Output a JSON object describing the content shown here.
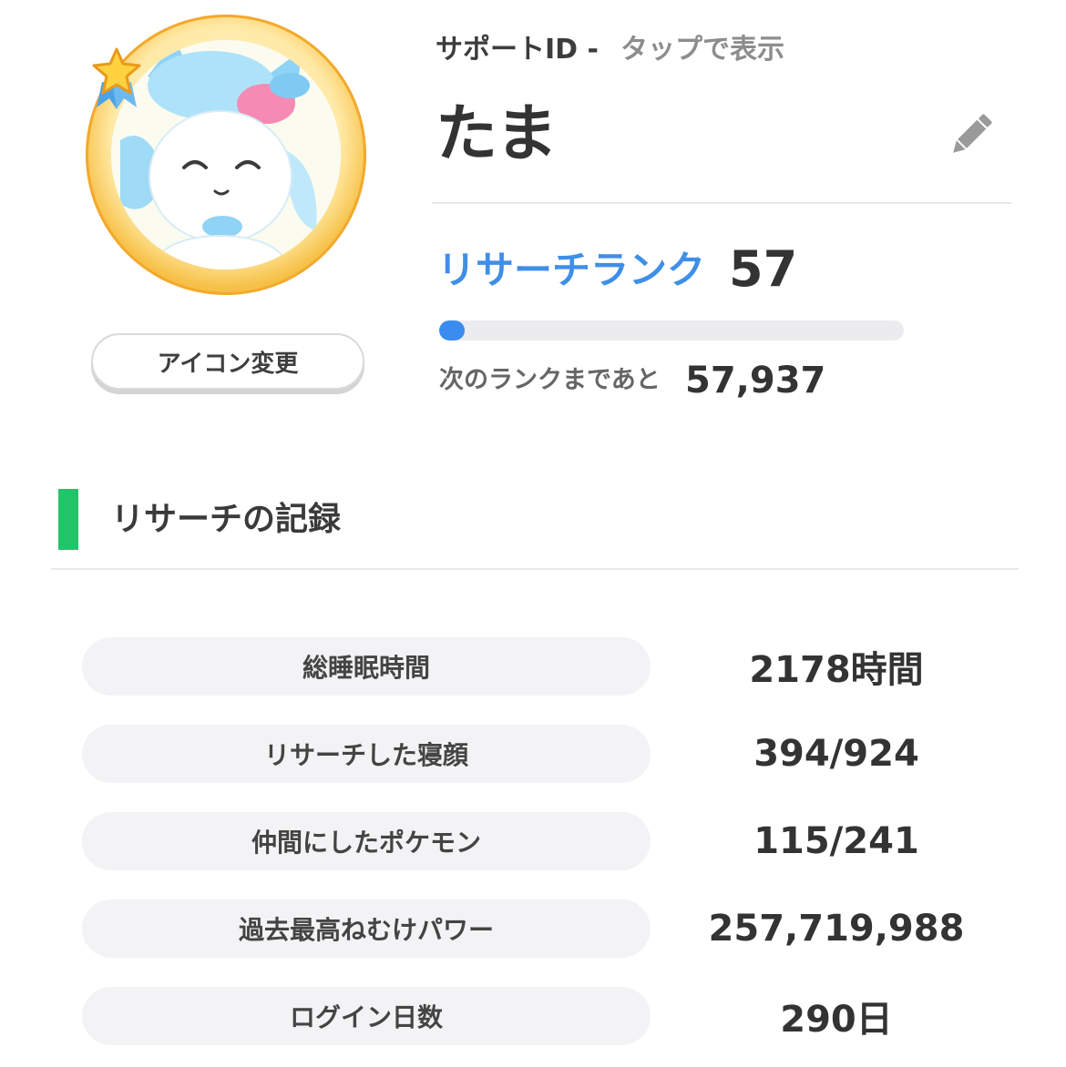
{
  "profile": {
    "support_id_label": "サポートID -",
    "support_id_value": "タップで表示",
    "name": "たま",
    "edit_icon": "pencil-icon",
    "avatar_icon": "sylveon-portrait",
    "badge_icon": "star-ribbon-icon",
    "icon_change_label": "アイコン変更"
  },
  "rank": {
    "label": "リサーチランク",
    "value": "57",
    "progress_fraction": 0.055,
    "next_label": "次のランクまであと",
    "next_value": "57,937",
    "accent_color": "#3f8fe8",
    "bar_color": "#3a8cf0"
  },
  "section": {
    "title": "リサーチの記録",
    "accent_color": "#22c46a"
  },
  "stats": [
    {
      "label": "総睡眠時間",
      "value": "2178時間"
    },
    {
      "label": "リサーチした寝顔",
      "value": "394/924"
    },
    {
      "label": "仲間にしたポケモン",
      "value": "115/241"
    },
    {
      "label": "過去最高ねむけパワー",
      "value": "257,719,988"
    },
    {
      "label": "ログイン日数",
      "value": "290日"
    }
  ]
}
